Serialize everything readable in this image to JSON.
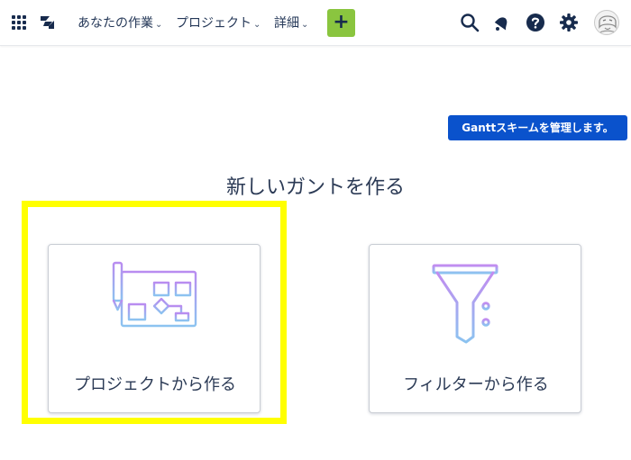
{
  "topbar": {
    "apps_icon": "app-switcher-grid-icon",
    "logo_icon": "jira-logo-icon",
    "nav": [
      {
        "label": "あなたの作業"
      },
      {
        "label": "プロジェクト"
      },
      {
        "label": "詳細"
      }
    ],
    "create_label": "+",
    "create_color": "#8ac53f",
    "icons": [
      "search-icon",
      "notifications-icon",
      "help-icon",
      "settings-icon",
      "user-avatar"
    ]
  },
  "manage_button": {
    "label": "Ganttスキームを管理します。",
    "color": "#0a52cc"
  },
  "main": {
    "heading": "新しいガントを作る",
    "cards": [
      {
        "label": "プロジェクトから作る",
        "icon": "project-blueprint-icon"
      },
      {
        "label": "フィルターから作る",
        "icon": "filter-funnel-icon"
      }
    ]
  },
  "highlight_color": "#ffff00"
}
